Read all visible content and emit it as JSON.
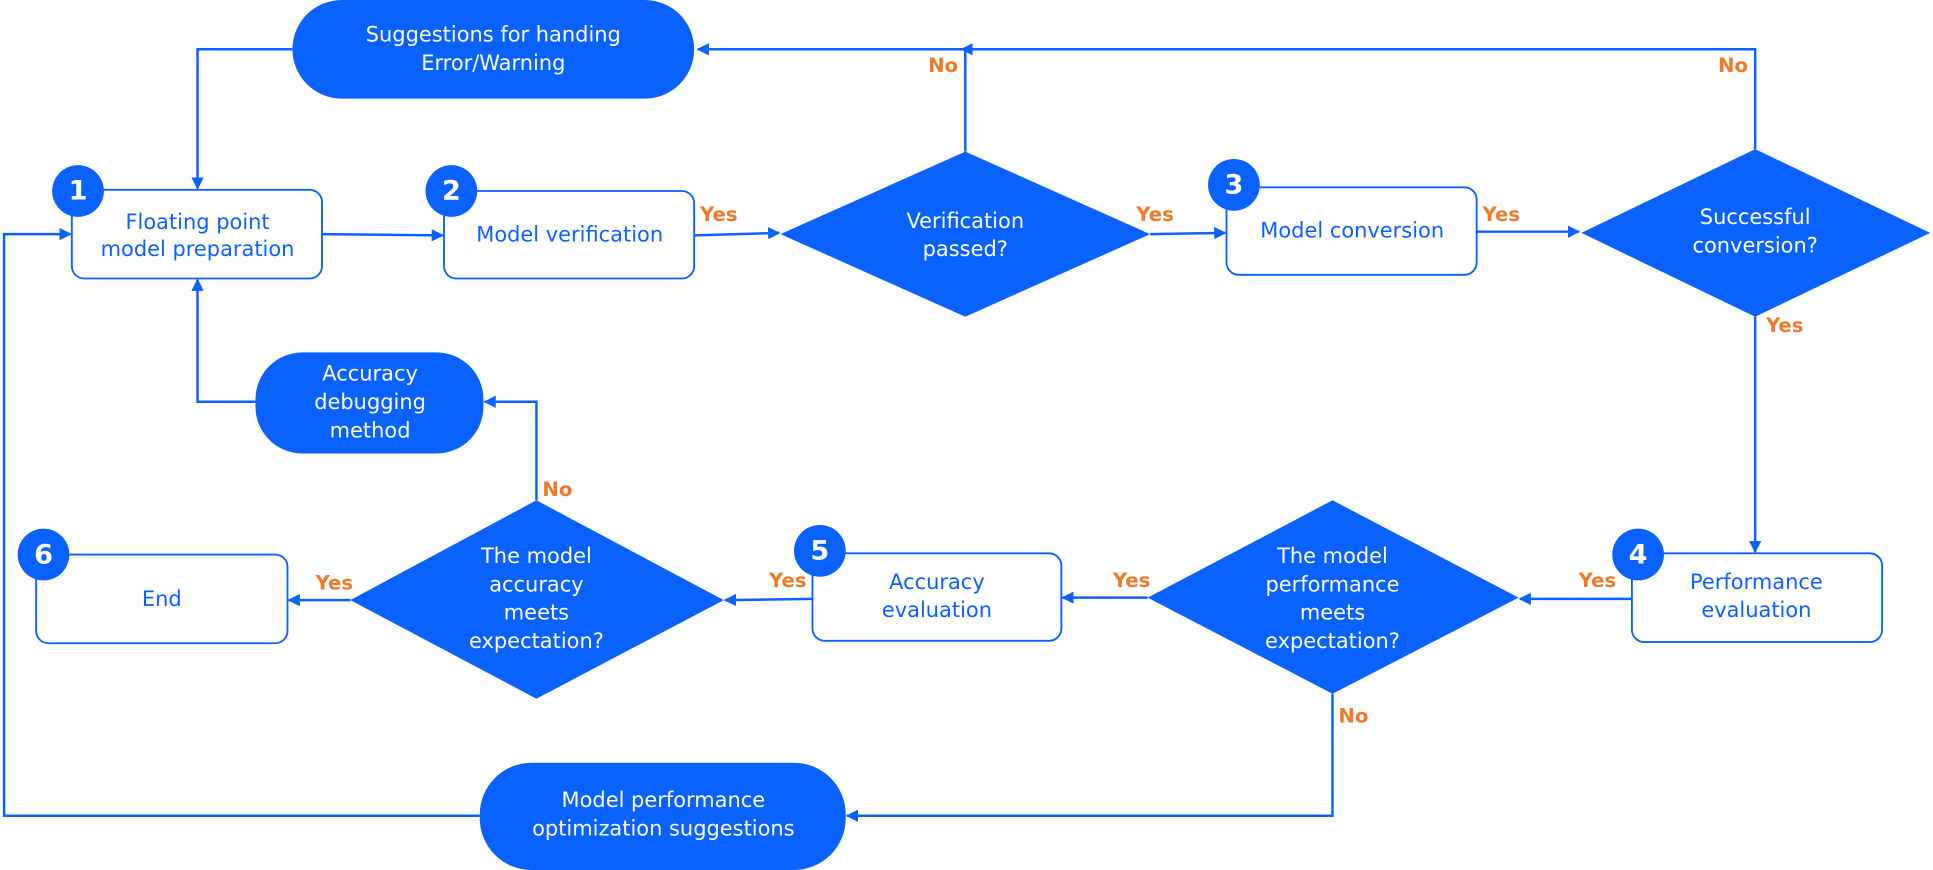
{
  "colors": {
    "primary": "#0a62fe",
    "label": "#f07a2a"
  },
  "terminals": {
    "error_warning": [
      "Suggestions for handing",
      "Error/Warning"
    ],
    "accuracy_debug": [
      "Accuracy",
      "debugging",
      "method"
    ],
    "perf_opt": [
      "Model performance",
      "optimization suggestions"
    ]
  },
  "steps": [
    {
      "num": "1",
      "lines": [
        "Floating point",
        "model preparation"
      ]
    },
    {
      "num": "2",
      "lines": [
        "Model verification"
      ]
    },
    {
      "num": "3",
      "lines": [
        "Model conversion"
      ]
    },
    {
      "num": "4",
      "lines": [
        "Performance",
        "evaluation"
      ]
    },
    {
      "num": "5",
      "lines": [
        "Accuracy",
        "evaluation"
      ]
    },
    {
      "num": "6",
      "lines": [
        "End"
      ]
    }
  ],
  "decisions": {
    "verification": [
      "Verification",
      "passed?"
    ],
    "conversion": [
      "Successful",
      "conversion?"
    ],
    "performance": [
      "The model",
      "performance",
      "meets",
      "expectation?"
    ],
    "accuracy": [
      "The model",
      "accuracy",
      "meets",
      "expectation?"
    ]
  },
  "edge_labels": {
    "yes": "Yes",
    "no": "No"
  }
}
